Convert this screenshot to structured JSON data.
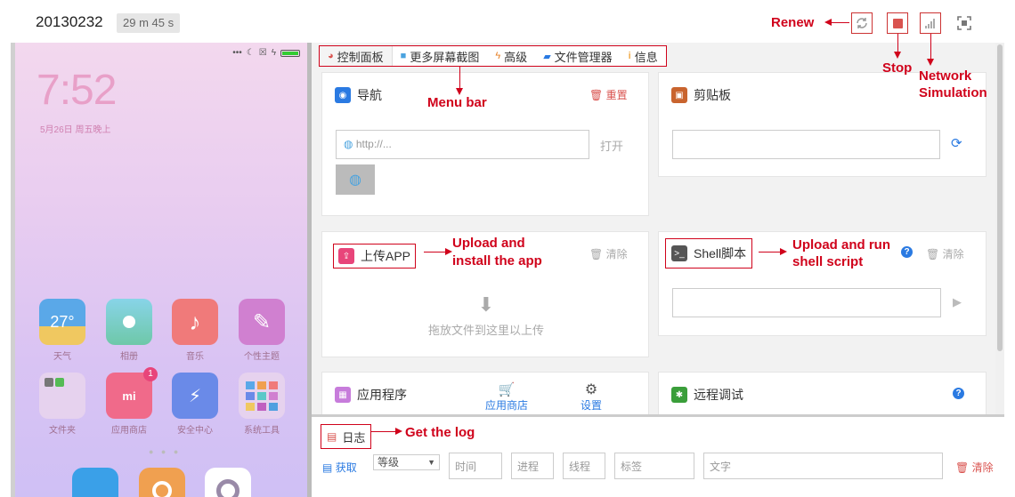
{
  "header": {
    "device_id": "20130232",
    "timer": "29 m 45 s",
    "buttons": [
      {
        "name": "renew",
        "icon": "refresh-icon"
      },
      {
        "name": "stop",
        "icon": "stop-icon"
      },
      {
        "name": "network",
        "icon": "signal-icon"
      },
      {
        "name": "fullscreen",
        "icon": "fullscreen-icon"
      }
    ]
  },
  "annotations": {
    "renew": "Renew",
    "stop": "Stop",
    "network_l1": "Network",
    "network_l2": "Simulation",
    "menu_bar": "Menu bar",
    "upload_l1": "Upload and",
    "upload_l2": "install the app",
    "shell_l1": "Upload and run",
    "shell_l2": "shell script",
    "log": "Get the log"
  },
  "phone": {
    "time": "7:52",
    "date": "5月26日 周五晚上",
    "apps_row1": [
      {
        "label": "天气",
        "text": "27°",
        "color": "#5aa8e8"
      },
      {
        "label": "相册",
        "text": "",
        "color": "#6ec8b8"
      },
      {
        "label": "音乐",
        "text": "♪",
        "color": "#f07a7a"
      },
      {
        "label": "个性主题",
        "text": "✎",
        "color": "#d080d0"
      }
    ],
    "apps_row2": [
      {
        "label": "文件夹",
        "text": "",
        "color": "#e0c8ec"
      },
      {
        "label": "应用商店",
        "text": "mi",
        "color": "#f06a8a",
        "badge": "1"
      },
      {
        "label": "安全中心",
        "text": "⚡",
        "color": "#6a8ae8"
      },
      {
        "label": "系统工具",
        "text": "",
        "color": "#e0c8ec"
      }
    ]
  },
  "menu": {
    "items": [
      {
        "label": "控制面板",
        "icon": "dashboard-icon",
        "color": "#d9534f"
      },
      {
        "label": "更多屏幕截图",
        "icon": "camera-icon",
        "color": "#4aa3df"
      },
      {
        "label": "高级",
        "icon": "bolt-icon",
        "color": "#e67e22"
      },
      {
        "label": "文件管理器",
        "icon": "folder-icon",
        "color": "#2a7ae2"
      },
      {
        "label": "信息",
        "icon": "info-icon",
        "color": "#f0ad4e"
      }
    ]
  },
  "panels": {
    "nav": {
      "title": "导航",
      "reset": "重置",
      "placeholder": "http://...",
      "open": "打开"
    },
    "clipboard": {
      "title": "剪贴板"
    },
    "upload": {
      "title": "上传APP",
      "clear": "清除",
      "drop_hint": "拖放文件到这里以上传"
    },
    "shell": {
      "title": "Shell脚本",
      "clear": "清除"
    },
    "apps": {
      "title": "应用程序",
      "store": "应用商店",
      "settings": "设置"
    },
    "remote": {
      "title": "远程调试"
    }
  },
  "log": {
    "title": "日志",
    "fetch": "获取",
    "level": "等级",
    "time_ph": "时间",
    "process_ph": "进程",
    "thread_ph": "线程",
    "tag_ph": "标签",
    "text_ph": "文字",
    "clear": "清除"
  }
}
